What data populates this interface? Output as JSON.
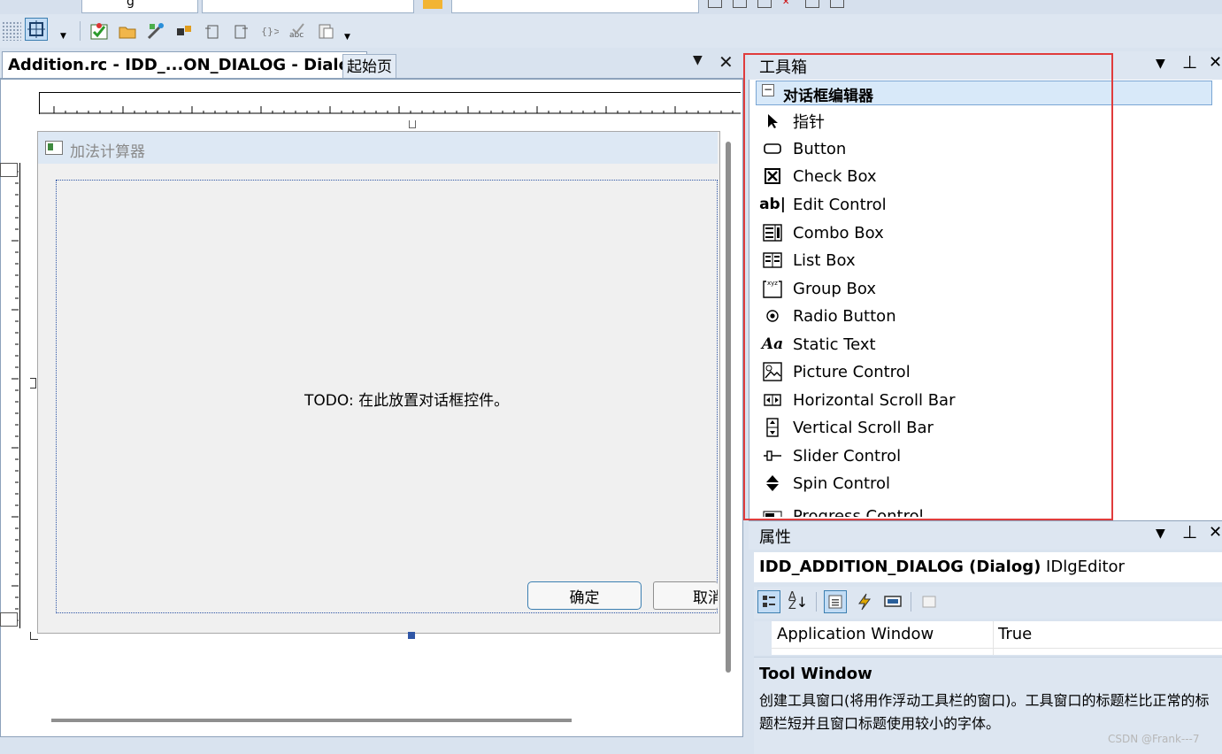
{
  "toolbar": {
    "combo_partial": "g"
  },
  "tabs": {
    "active": "Addition.rc - IDD_...ON_DIALOG - Dialog",
    "inactive": "起始页",
    "dropdown_glyph": "▼",
    "close_glyph": "✕"
  },
  "dialog": {
    "title": "加法计算器",
    "todo_text": "TODO: 在此放置对话框控件。",
    "ok_label": "确定",
    "cancel_label": "取消"
  },
  "toolbox": {
    "title": "工具箱",
    "category": "对话框编辑器",
    "items": [
      {
        "label": "指针",
        "icon": "pointer-icon"
      },
      {
        "label": "Button",
        "icon": "button-icon"
      },
      {
        "label": "Check Box",
        "icon": "checkbox-icon"
      },
      {
        "label": "Edit Control",
        "icon": "edit-icon"
      },
      {
        "label": "Combo Box",
        "icon": "combo-icon"
      },
      {
        "label": "List Box",
        "icon": "listbox-icon"
      },
      {
        "label": "Group Box",
        "icon": "groupbox-icon"
      },
      {
        "label": "Radio Button",
        "icon": "radio-icon"
      },
      {
        "label": "Static Text",
        "icon": "static-text-icon"
      },
      {
        "label": "Picture Control",
        "icon": "picture-icon"
      },
      {
        "label": "Horizontal Scroll Bar",
        "icon": "hscroll-icon"
      },
      {
        "label": "Vertical Scroll Bar",
        "icon": "vscroll-icon"
      },
      {
        "label": "Slider Control",
        "icon": "slider-icon"
      },
      {
        "label": "Spin Control",
        "icon": "spin-icon"
      },
      {
        "label": "Progress Control",
        "icon": "progress-icon"
      }
    ]
  },
  "properties": {
    "title": "属性",
    "object_bold": "IDD_ADDITION_DIALOG (Dialog)",
    "object_type": "IDlgEditor",
    "rows": [
      {
        "name": "Application Window",
        "value": "True"
      }
    ],
    "desc_title": "Tool Window",
    "desc_text": "创建工具窗口(将用作浮动工具栏的窗口)。工具窗口的标题栏比正常的标题栏短并且窗口标题使用较小的字体。"
  },
  "watermark": "CSDN @Frank---7",
  "colors": {
    "accent_blue": "#3c7fb1",
    "highlight_red": "#e03c3c",
    "panel_bg": "#dde6f1"
  }
}
